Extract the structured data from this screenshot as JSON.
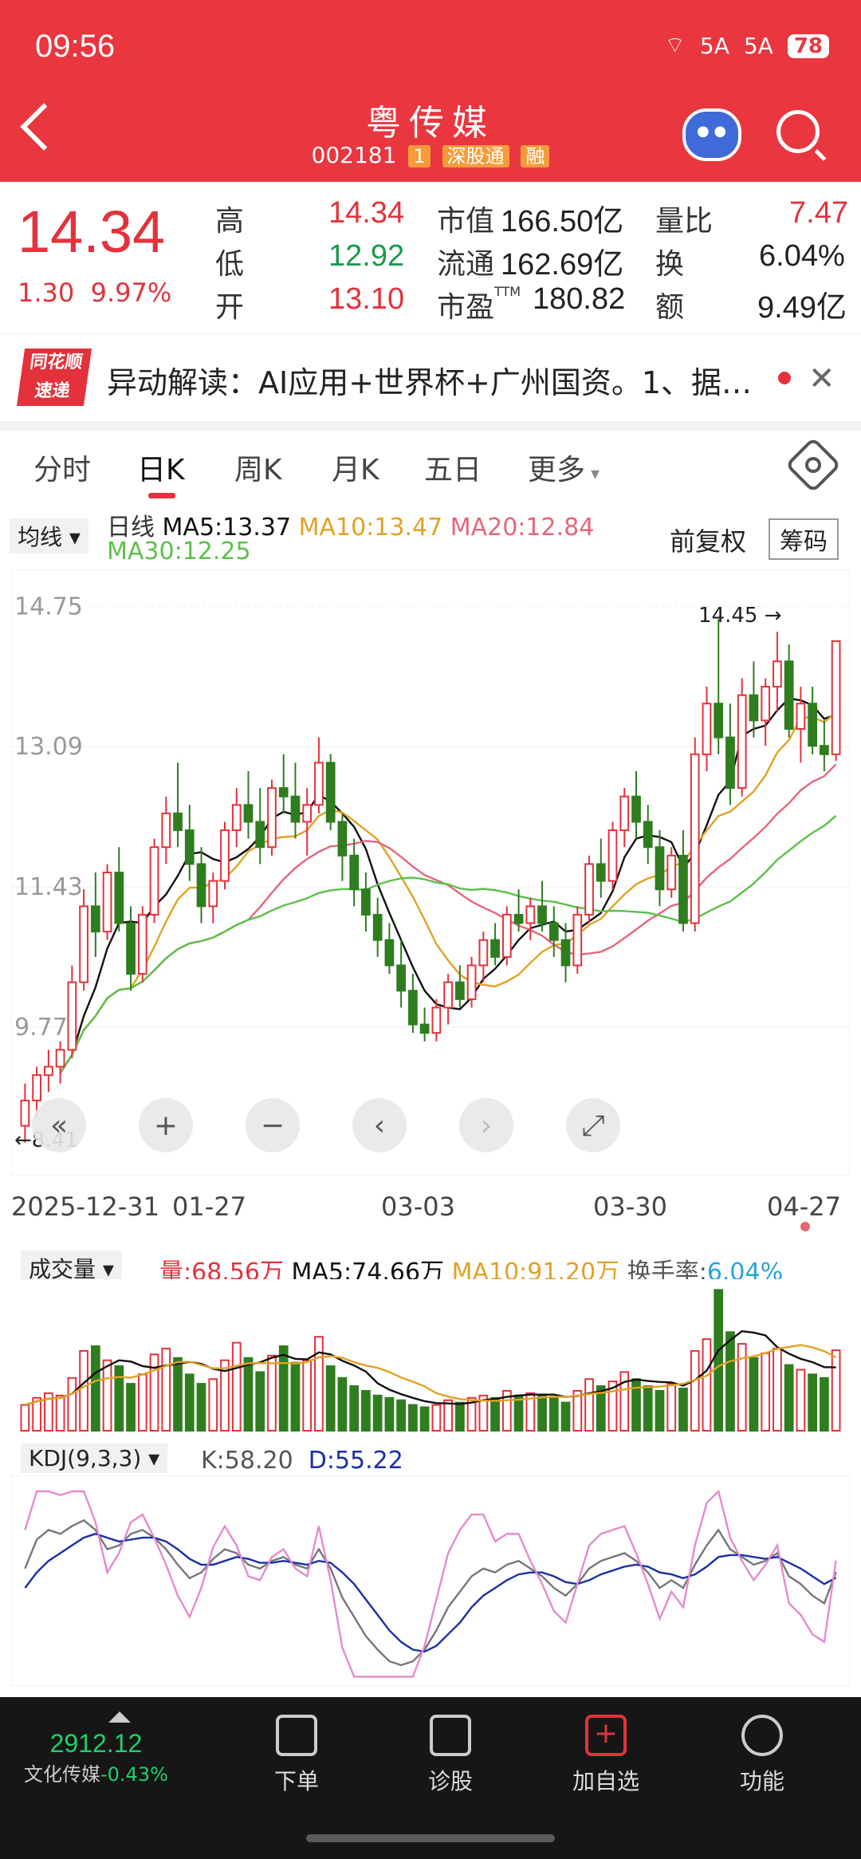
{
  "status": {
    "time": "09:56",
    "signal1": "5A",
    "signal2": "5A",
    "battery": "78"
  },
  "header": {
    "name": "粤传媒",
    "code": "002181",
    "tag1": "1",
    "tag2": "深股通",
    "tag3": "融"
  },
  "quote": {
    "price": "14.34",
    "change": "1.30",
    "change_pct": "9.97%",
    "high_label": "高",
    "high": "14.34",
    "low_label": "低",
    "low": "12.92",
    "open_label": "开",
    "open": "13.10",
    "mcap_label": "市值",
    "mcap": "166.50亿",
    "float_label": "流通",
    "float_cap": "162.69亿",
    "pe_label": "市盈",
    "pe_sup": "TTM",
    "pe": "180.82",
    "vr_label": "量比",
    "vr": "7.47",
    "turn_label": "换",
    "turn": "6.04%",
    "amt_label": "额",
    "amt": "9.49亿"
  },
  "news": {
    "logo_top": "同花顺",
    "logo_bottom": "速递",
    "text": "异动解读：AI应用+世界杯+广州国资。1、据…"
  },
  "tabs": [
    "分时",
    "日K",
    "周K",
    "月K",
    "五日",
    "更多"
  ],
  "ma": {
    "btn": "均线",
    "day": "日线",
    "ma5": "MA5:13.37",
    "ma10": "MA10:13.47",
    "ma20": "MA20:12.84",
    "ma30": "MA30:12.25",
    "fq": "前复权",
    "chouma": "筹码"
  },
  "colors": {
    "up": "#e3323b",
    "down": "#2e7d1f",
    "ma5": "#111111",
    "ma10": "#e1a223",
    "ma20": "#e5667c",
    "ma30": "#5cc04a"
  },
  "kchart": {
    "yticks": [
      "14.75",
      "13.09",
      "11.43",
      "9.77"
    ],
    "high_label": "14.45 →",
    "low_label": "←8.41",
    "xlabels": [
      "2025-12-31",
      "01-27",
      "03-03",
      "03-30",
      "04-27"
    ],
    "controls": [
      "«",
      "+",
      "−",
      "‹",
      "›",
      "⤢"
    ]
  },
  "volume": {
    "btn": "成交量",
    "vol": "量:68.56万",
    "ma5": "MA5:74.66万",
    "ma10": "MA10:91.20万",
    "turn_label": "换手率:",
    "turn": "6.04%"
  },
  "kdj": {
    "btn": "KDJ(9,3,3)",
    "k": "K:58.20",
    "d": "D:55.22"
  },
  "chart_data": {
    "type": "candlestick",
    "ylim": [
      8.41,
      14.75
    ],
    "x_start": "2025-12-31",
    "x_end": "04-27",
    "ohlc": [
      [
        8.6,
        9.1,
        8.4,
        8.9
      ],
      [
        8.9,
        9.3,
        8.7,
        9.2
      ],
      [
        9.2,
        9.5,
        9.0,
        9.3
      ],
      [
        9.3,
        9.6,
        9.1,
        9.5
      ],
      [
        9.5,
        10.5,
        9.4,
        10.3
      ],
      [
        10.3,
        11.4,
        10.2,
        11.2
      ],
      [
        11.2,
        11.6,
        10.6,
        10.9
      ],
      [
        10.9,
        11.7,
        10.8,
        11.6
      ],
      [
        11.6,
        11.9,
        10.9,
        11.0
      ],
      [
        11.0,
        11.2,
        10.2,
        10.4
      ],
      [
        10.4,
        11.2,
        10.3,
        11.1
      ],
      [
        11.1,
        12.0,
        11.0,
        11.9
      ],
      [
        11.9,
        12.5,
        11.7,
        12.3
      ],
      [
        12.3,
        12.9,
        11.9,
        12.1
      ],
      [
        12.1,
        12.4,
        11.5,
        11.7
      ],
      [
        11.7,
        11.9,
        11.0,
        11.2
      ],
      [
        11.2,
        11.6,
        11.0,
        11.5
      ],
      [
        11.5,
        12.2,
        11.4,
        12.1
      ],
      [
        12.1,
        12.6,
        11.9,
        12.4
      ],
      [
        12.4,
        12.8,
        12.0,
        12.2
      ],
      [
        12.2,
        12.6,
        11.7,
        11.9
      ],
      [
        11.9,
        12.7,
        11.8,
        12.6
      ],
      [
        12.6,
        13.0,
        12.3,
        12.5
      ],
      [
        12.5,
        12.9,
        12.0,
        12.2
      ],
      [
        12.2,
        12.6,
        11.8,
        12.4
      ],
      [
        12.4,
        13.2,
        12.3,
        12.9
      ],
      [
        12.9,
        13.0,
        12.1,
        12.2
      ],
      [
        12.2,
        12.3,
        11.5,
        11.8
      ],
      [
        11.8,
        12.0,
        11.2,
        11.4
      ],
      [
        11.4,
        11.6,
        10.9,
        11.1
      ],
      [
        11.1,
        11.3,
        10.6,
        10.8
      ],
      [
        10.8,
        11.0,
        10.4,
        10.5
      ],
      [
        10.5,
        10.8,
        10.0,
        10.2
      ],
      [
        10.2,
        10.4,
        9.7,
        9.8
      ],
      [
        9.8,
        10.0,
        9.6,
        9.7
      ],
      [
        9.7,
        10.1,
        9.6,
        10.0
      ],
      [
        10.0,
        10.4,
        9.8,
        10.3
      ],
      [
        10.3,
        10.5,
        10.0,
        10.1
      ],
      [
        10.1,
        10.6,
        10.0,
        10.5
      ],
      [
        10.5,
        10.9,
        10.3,
        10.8
      ],
      [
        10.8,
        11.0,
        10.5,
        10.6
      ],
      [
        10.6,
        11.2,
        10.5,
        11.1
      ],
      [
        11.1,
        11.4,
        10.9,
        11.0
      ],
      [
        11.0,
        11.3,
        10.8,
        11.2
      ],
      [
        11.2,
        11.5,
        10.9,
        11.0
      ],
      [
        11.0,
        11.2,
        10.6,
        10.8
      ],
      [
        10.8,
        11.0,
        10.3,
        10.5
      ],
      [
        10.5,
        11.2,
        10.4,
        11.1
      ],
      [
        11.1,
        11.8,
        11.0,
        11.7
      ],
      [
        11.7,
        12.0,
        11.3,
        11.5
      ],
      [
        11.5,
        12.2,
        11.4,
        12.1
      ],
      [
        12.1,
        12.6,
        11.9,
        12.5
      ],
      [
        12.5,
        12.8,
        12.0,
        12.2
      ],
      [
        12.2,
        12.4,
        11.7,
        11.9
      ],
      [
        11.9,
        12.1,
        11.2,
        11.4
      ],
      [
        11.4,
        11.9,
        11.3,
        11.8
      ],
      [
        11.8,
        12.1,
        10.9,
        11.0
      ],
      [
        11.0,
        13.2,
        10.9,
        13.0
      ],
      [
        13.0,
        13.8,
        12.8,
        13.6
      ],
      [
        13.6,
        14.6,
        13.0,
        13.2
      ],
      [
        13.2,
        13.6,
        12.4,
        12.6
      ],
      [
        12.6,
        13.9,
        12.5,
        13.7
      ],
      [
        13.7,
        14.1,
        13.2,
        13.4
      ],
      [
        13.4,
        13.9,
        13.1,
        13.8
      ],
      [
        13.8,
        14.45,
        13.5,
        14.1
      ],
      [
        14.1,
        14.3,
        13.2,
        13.3
      ],
      [
        13.3,
        13.8,
        12.9,
        13.6
      ],
      [
        13.6,
        13.8,
        13.0,
        13.1
      ],
      [
        13.1,
        13.4,
        12.8,
        13.0
      ],
      [
        13.0,
        14.34,
        12.92,
        14.34
      ]
    ],
    "volume": [
      22,
      28,
      32,
      30,
      45,
      68,
      72,
      60,
      55,
      40,
      48,
      65,
      70,
      62,
      48,
      40,
      44,
      60,
      75,
      62,
      50,
      64,
      72,
      58,
      60,
      80,
      55,
      45,
      38,
      34,
      30,
      28,
      26,
      22,
      20,
      22,
      26,
      24,
      28,
      30,
      28,
      34,
      30,
      32,
      30,
      28,
      24,
      34,
      44,
      38,
      42,
      50,
      44,
      38,
      34,
      40,
      36,
      68,
      78,
      120,
      84,
      74,
      62,
      66,
      70,
      56,
      52,
      48,
      45,
      68.56
    ],
    "kdj_k": [
      60,
      75,
      80,
      78,
      82,
      85,
      80,
      70,
      72,
      78,
      80,
      76,
      70,
      62,
      55,
      58,
      65,
      70,
      68,
      62,
      60,
      64,
      66,
      62,
      60,
      70,
      60,
      45,
      35,
      25,
      18,
      12,
      10,
      12,
      18,
      28,
      40,
      48,
      56,
      60,
      58,
      62,
      64,
      60,
      56,
      50,
      46,
      52,
      60,
      64,
      66,
      68,
      64,
      58,
      50,
      54,
      50,
      62,
      72,
      80,
      70,
      66,
      62,
      64,
      68,
      56,
      52,
      46,
      42,
      58.2
    ],
    "kdj_d": [
      50,
      58,
      64,
      68,
      72,
      76,
      78,
      76,
      74,
      75,
      76,
      76,
      74,
      70,
      65,
      62,
      62,
      64,
      66,
      65,
      63,
      63,
      64,
      63,
      62,
      64,
      63,
      58,
      52,
      44,
      36,
      28,
      22,
      18,
      17,
      20,
      26,
      32,
      40,
      46,
      50,
      54,
      57,
      58,
      58,
      56,
      53,
      52,
      54,
      57,
      59,
      61,
      62,
      61,
      58,
      57,
      55,
      57,
      61,
      66,
      67,
      67,
      66,
      65,
      66,
      63,
      60,
      56,
      52,
      55.22
    ]
  }
}
